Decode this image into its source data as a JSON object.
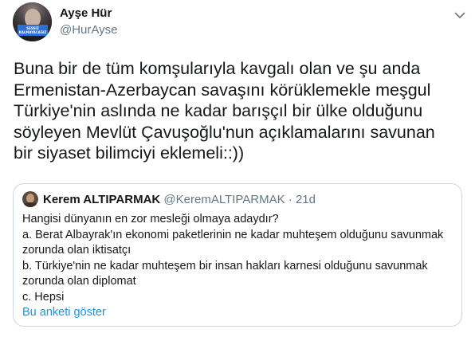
{
  "tweet": {
    "author_name": "Ayşe Hür",
    "author_handle": "@HurAyse",
    "avatar_banner_text": "SESSİZ KALMAYACAĞIZ",
    "text_lines": [
      "Buna bir de tüm komşularıyla kavgalı olan ve şu anda",
      "Ermenistan-Azerbaycan savaşını körüklemekle meşgul",
      "Türkiye'nin aslında ne kadar barışçıl bir ülke olduğunu",
      "söyleyen Mevlüt Çavuşoğlu'nun açıklamalarını savunan",
      "bir siyaset bilimciyi eklemeli::))"
    ]
  },
  "quoted_tweet": {
    "author_name": "Kerem ALTIPARMAK",
    "author_handle": "@KeremALTIPARMAK",
    "separator": "·",
    "timestamp": "21d",
    "text_lines": [
      "Hangisi dünyanın en zor mesleği olmaya adaydır?",
      "a. Berat Albayrak'ın ekonomi paketlerinin ne kadar muhteşem olduğunu savunmak",
      "zorunda olan iktisatçı",
      "b. Türkiye'nin ne kadar muhteşem bir insan hakları karnesi olduğunu savunmak",
      "zorunda olan diplomat",
      "c. Hepsi"
    ],
    "poll_link": "Bu anketi göster"
  },
  "icons": {
    "menu": "chevron-down-icon"
  },
  "colors": {
    "text_primary": "#14171a",
    "text_secondary": "#657786",
    "link": "#1b95e0",
    "border": "#ccd6dd"
  }
}
